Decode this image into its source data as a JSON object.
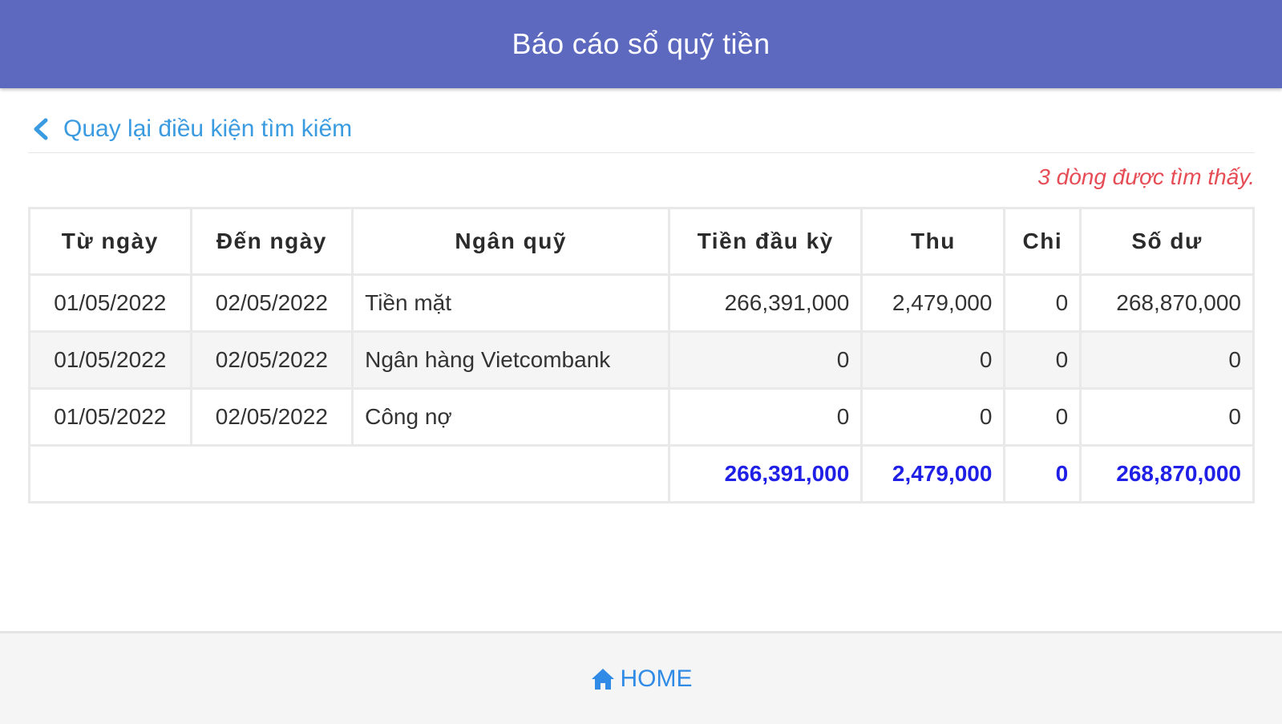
{
  "header": {
    "title": "Báo cáo sổ quỹ tiền"
  },
  "back": {
    "icon": "chevron-left-icon",
    "label": "Quay lại điều kiện tìm kiếm",
    "color": "#3b9be0"
  },
  "result": {
    "found_text": "3 dòng được tìm thấy.",
    "color": "#e64c55"
  },
  "table": {
    "columns": [
      "Từ ngày",
      "Đến ngày",
      "Ngân quỹ",
      "Tiền đầu kỳ",
      "Thu",
      "Chi",
      "Số dư"
    ],
    "rows": [
      [
        "01/05/2022",
        "02/05/2022",
        "Tiền mặt",
        "266,391,000",
        "2,479,000",
        "0",
        "268,870,000"
      ],
      [
        "01/05/2022",
        "02/05/2022",
        "Ngân hàng Vietcombank",
        "0",
        "0",
        "0",
        "0"
      ],
      [
        "01/05/2022",
        "02/05/2022",
        "Công nợ",
        "0",
        "0",
        "0",
        "0"
      ]
    ],
    "totals": {
      "opening": "266,391,000",
      "income": "2,479,000",
      "expense": "0",
      "balance": "268,870,000"
    },
    "total_color": "#1f1fe6"
  },
  "footer": {
    "home_icon": "home-icon",
    "home_label": "HOME"
  },
  "colors": {
    "header_bg": "#5c69bf",
    "link": "#2f8be6"
  }
}
